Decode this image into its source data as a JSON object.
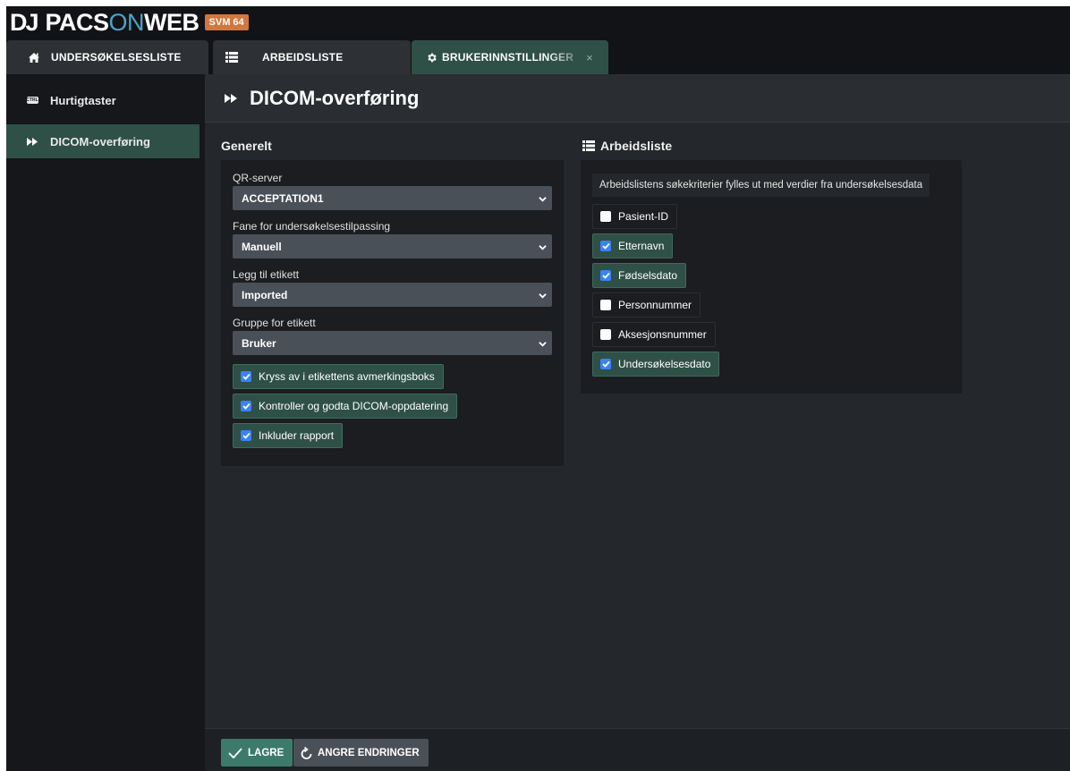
{
  "header": {
    "logo_dj": "DJ",
    "logo_pacs": "PACS",
    "logo_on": "ON",
    "logo_web": "WEB",
    "badge": "SVM 64"
  },
  "tabs": [
    {
      "label": "UNDERSØKELSESLISTE",
      "icon": "home-icon"
    },
    {
      "label": "ARBEIDSLISTE",
      "icon": "list-icon"
    },
    {
      "label": "BRUKERINNSTILLINGER",
      "icon": "gear-icon",
      "close": "×"
    }
  ],
  "sidebar": {
    "items": [
      {
        "label": "Hurtigtaster",
        "icon": "ctrl-key-icon",
        "icon_text": "CTRL"
      },
      {
        "label": "DICOM-overføring",
        "icon": "fast-forward-icon"
      }
    ]
  },
  "main": {
    "title": "DICOM-overføring",
    "general": {
      "title": "Generelt",
      "fields": [
        {
          "label": "QR-server",
          "value": "ACCEPTATION1"
        },
        {
          "label": "Fane for undersøkelsestilpassing",
          "value": "Manuell"
        },
        {
          "label": "Legg til etikett",
          "value": "Imported"
        },
        {
          "label": "Gruppe for etikett",
          "value": "Bruker"
        }
      ],
      "checkboxes": [
        {
          "label": "Kryss av i etikettens avmerkingsboks",
          "checked": true
        },
        {
          "label": "Kontroller og godta DICOM-oppdatering",
          "checked": true
        },
        {
          "label": "Inkluder rapport",
          "checked": true
        }
      ]
    },
    "worklist": {
      "title": "Arbeidsliste",
      "info": "Arbeidslistens søkekriterier fylles ut med verdier fra undersøkelsesdata",
      "checkboxes": [
        {
          "label": "Pasient-ID",
          "checked": false
        },
        {
          "label": "Etternavn",
          "checked": true
        },
        {
          "label": "Fødselsdato",
          "checked": true
        },
        {
          "label": "Personnummer",
          "checked": false
        },
        {
          "label": "Aksesjonsnummer",
          "checked": false
        },
        {
          "label": "Undersøkelsesdato",
          "checked": true
        }
      ]
    }
  },
  "footer": {
    "save_label": "LAGRE",
    "undo_label": "ANGRE ENDRINGER"
  },
  "colors": {
    "accent": "#2f5046",
    "badge": "#d2773d",
    "checkbox": "#3b82f6"
  }
}
